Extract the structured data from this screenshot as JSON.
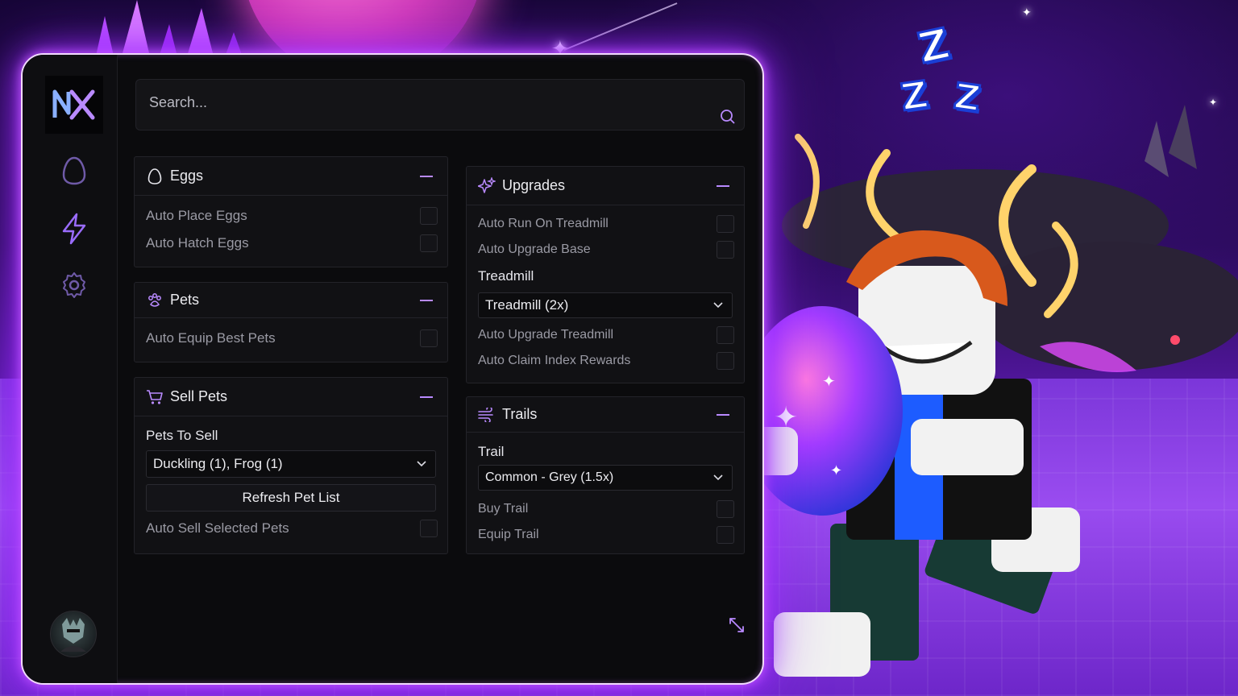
{
  "search": {
    "placeholder": "Search..."
  },
  "sidebar": {
    "items": [
      {
        "name": "egg-icon"
      },
      {
        "name": "lightning-icon"
      },
      {
        "name": "gear-icon"
      }
    ]
  },
  "panels": {
    "eggs": {
      "title": "Eggs",
      "toggles": [
        {
          "label": "Auto Place Eggs",
          "checked": false
        },
        {
          "label": "Auto Hatch Eggs",
          "checked": false
        }
      ]
    },
    "pets": {
      "title": "Pets",
      "toggles": [
        {
          "label": "Auto Equip Best Pets",
          "checked": false
        }
      ]
    },
    "sell_pets": {
      "title": "Sell Pets",
      "label": "Pets To Sell",
      "dropdown_value": "Duckling (1), Frog (1)",
      "button_label": "Refresh Pet List",
      "toggles": [
        {
          "label": "Auto Sell Selected Pets",
          "checked": false
        }
      ]
    },
    "upgrades": {
      "title": "Upgrades",
      "toggles_top": [
        {
          "label": "Auto Run On Treadmill",
          "checked": false
        },
        {
          "label": "Auto Upgrade Base",
          "checked": false
        }
      ],
      "label": "Treadmill",
      "dropdown_value": "Treadmill (2x)",
      "toggles_bottom": [
        {
          "label": "Auto Upgrade Treadmill",
          "checked": false
        },
        {
          "label": "Auto Claim Index Rewards",
          "checked": false
        }
      ]
    },
    "trails": {
      "title": "Trails",
      "label": "Trail",
      "dropdown_value": "Common - Grey (1.5x)",
      "toggles": [
        {
          "label": "Buy Trail",
          "checked": false
        },
        {
          "label": "Equip Trail",
          "checked": false
        }
      ]
    }
  },
  "colors": {
    "accent": "#b98aff",
    "window_bg": "#0b0b0d",
    "glow": "#9b2cff"
  }
}
